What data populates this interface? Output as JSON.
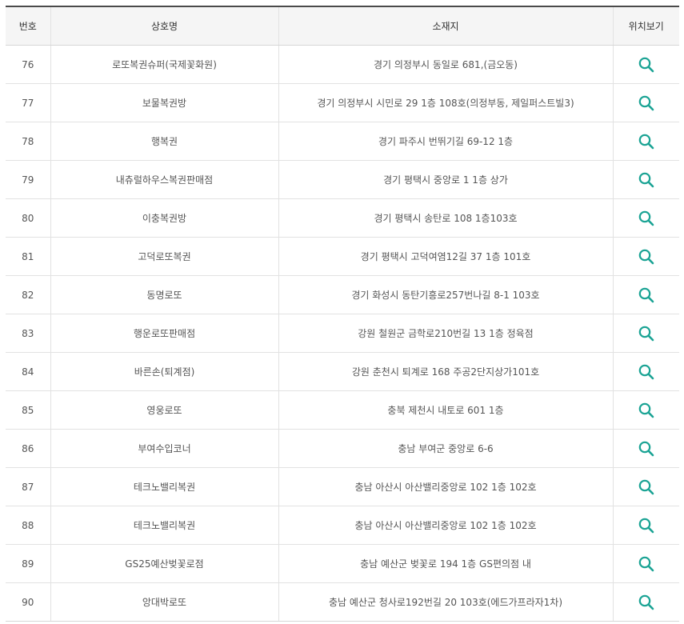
{
  "colors": {
    "accent": "#1aa394",
    "header_bg": "#f5f5f5",
    "border": "#e2e2e2",
    "header_rule": "#4a4a4a"
  },
  "table": {
    "headers": {
      "number": "번호",
      "name": "상호명",
      "address": "소재지",
      "location": "위치보기"
    },
    "location_icon": "search-icon",
    "rows": [
      {
        "number": "76",
        "name": "로또복권슈퍼(국제꽃화원)",
        "address": "경기 의정부시 동일로 681,(금오동)"
      },
      {
        "number": "77",
        "name": "보물복권방",
        "address": "경기 의정부시 시민로 29 1층 108호(의정부동, 제일퍼스트빌3)"
      },
      {
        "number": "78",
        "name": "행복권",
        "address": "경기 파주시 번뛰기길 69-12 1층"
      },
      {
        "number": "79",
        "name": "내츄럴하우스복권판매점",
        "address": "경기 평택시 중앙로 1 1층 상가"
      },
      {
        "number": "80",
        "name": "이충복권방",
        "address": "경기 평택시 송탄로 108 1층103호"
      },
      {
        "number": "81",
        "name": "고덕로또복권",
        "address": "경기 평택시 고덕여염12길 37 1층 101호"
      },
      {
        "number": "82",
        "name": "동명로또",
        "address": "경기 화성시 동탄기흥로257번나길 8-1 103호"
      },
      {
        "number": "83",
        "name": "행운로또판매점",
        "address": "강원 철원군 금학로210번길 13 1층 정육점"
      },
      {
        "number": "84",
        "name": "바른손(퇴계점)",
        "address": "강원 춘천시 퇴계로 168 주공2단지상가101호"
      },
      {
        "number": "85",
        "name": "영웅로또",
        "address": "충북 제천시 내토로 601 1층"
      },
      {
        "number": "86",
        "name": "부여수입코너",
        "address": "충남 부여군 중앙로 6-6"
      },
      {
        "number": "87",
        "name": "테크노밸리복권",
        "address": "충남 아산시 아산밸리중앙로 102 1층 102호"
      },
      {
        "number": "88",
        "name": "테크노밸리복권",
        "address": "충남 아산시 아산밸리중앙로 102 1층 102호"
      },
      {
        "number": "89",
        "name": "GS25예산벚꽃로점",
        "address": "충남 예산군 벚꽃로 194 1층 GS편의점 내"
      },
      {
        "number": "90",
        "name": "앙대박로또",
        "address": "충남 예산군 청사로192번길 20 103호(에드가프라자1차)"
      }
    ]
  }
}
